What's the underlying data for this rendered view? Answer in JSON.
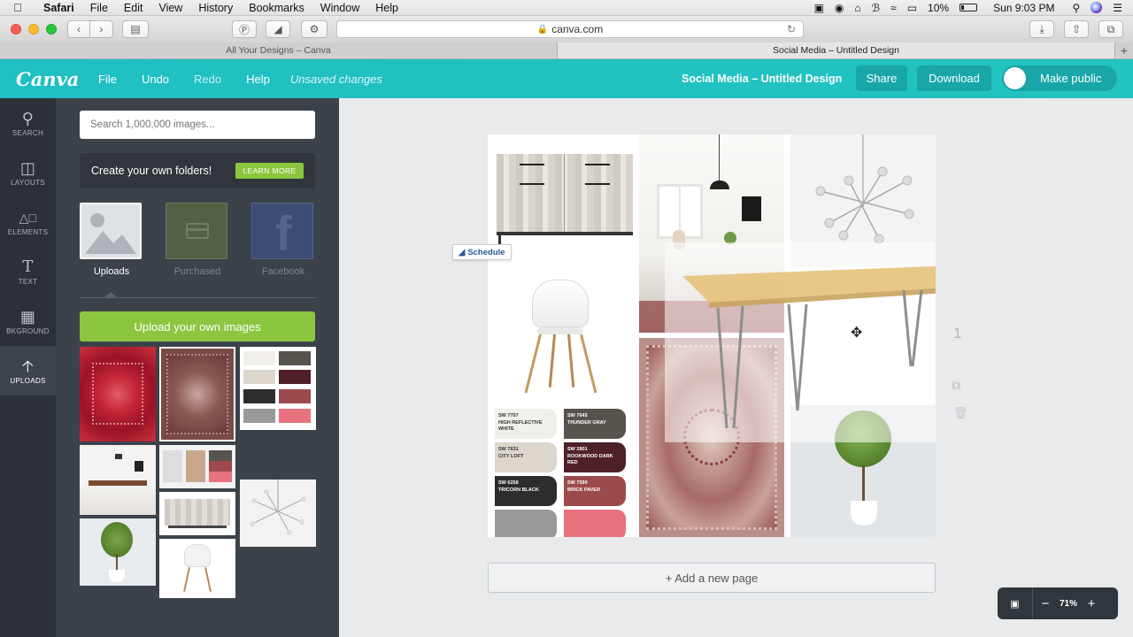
{
  "menubar": {
    "app": "Safari",
    "items": [
      "File",
      "Edit",
      "View",
      "History",
      "Bookmarks",
      "Window",
      "Help"
    ],
    "battery": "10%",
    "clock": "Sun 9:03 PM"
  },
  "safari": {
    "url": "canva.com",
    "tabs": [
      "All Your Designs – Canva",
      "Social Media – Untitled Design"
    ]
  },
  "header": {
    "logo": "Canva",
    "menu": {
      "file": "File",
      "undo": "Undo",
      "redo": "Redo",
      "help": "Help"
    },
    "status": "Unsaved changes",
    "design_title": "Social Media – Untitled Design",
    "share": "Share",
    "download": "Download",
    "make_public": "Make public"
  },
  "rail": {
    "items": [
      {
        "label": "SEARCH",
        "icon": "search-icon"
      },
      {
        "label": "LAYOUTS",
        "icon": "layouts-icon"
      },
      {
        "label": "ELEMENTS",
        "icon": "elements-icon"
      },
      {
        "label": "TEXT",
        "icon": "text-icon"
      },
      {
        "label": "BKGROUND",
        "icon": "background-icon"
      },
      {
        "label": "UPLOADS",
        "icon": "upload-arrow-icon"
      }
    ],
    "active": "UPLOADS"
  },
  "panel": {
    "search_placeholder": "Search 1,000,000 images...",
    "folders_text": "Create your own folders!",
    "learn_more": "LEARN MORE",
    "sources": [
      "Uploads",
      "Purchased",
      "Facebook"
    ],
    "upload_button": "Upload your own images"
  },
  "palette": {
    "swatches": [
      {
        "code": "SW 7757",
        "name": "HIGH REFLECTIVE WHITE",
        "color": "#f1efe9"
      },
      {
        "code": "SW 7645",
        "name": "THUNDER GRAY",
        "color": "#57534d"
      },
      {
        "code": "SW 7631",
        "name": "CITY LOFT",
        "color": "#dcd6cc"
      },
      {
        "code": "SW 2801",
        "name": "ROOKWOOD DARK RED",
        "color": "#4d2127"
      },
      {
        "code": "SW 6258",
        "name": "TRICORN BLACK",
        "color": "#2d2d2e"
      },
      {
        "code": "SW 7590",
        "name": "BRICK PAVER",
        "color": "#9c4a4c"
      },
      {
        "code": "",
        "name": "",
        "color": "#9a9a98"
      },
      {
        "code": "",
        "name": "",
        "color": "#e8737e"
      }
    ]
  },
  "canvas": {
    "schedule_label": "Schedule",
    "page_number": "1",
    "add_page": "+ Add a new page",
    "zoom": "71%"
  }
}
